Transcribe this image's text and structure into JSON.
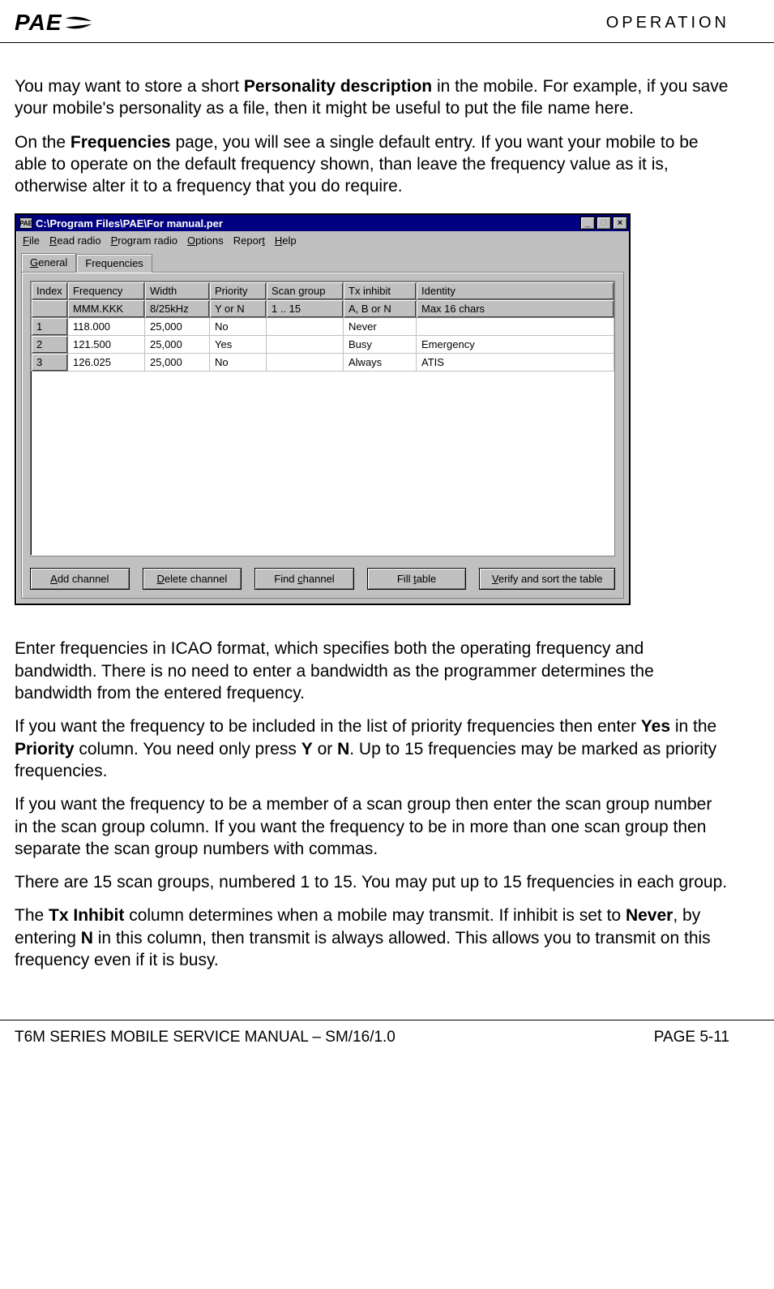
{
  "header": {
    "logo_text": "PAE",
    "section": "OPERATION"
  },
  "para1_a": "You may want to store a short ",
  "para1_b": "Personality description",
  "para1_c": " in the mobile.  For example, if you save your mobile's personality as a file, then it might be useful to put the file name here.",
  "para2_a": "On the ",
  "para2_b": "Frequencies",
  "para2_c": " page, you will see a single default entry.   If you want your mobile to be able to operate on the default frequency shown, than leave the frequency value as it is, otherwise alter it to a frequency that you do require.",
  "window": {
    "title": "C:\\Program Files\\PAE\\For manual.per",
    "icon_text": "PAE",
    "menus": {
      "file": "File",
      "read": "Read radio",
      "program": "Program radio",
      "options": "Options",
      "report": "Report",
      "help": "Help"
    },
    "tabs": {
      "general": "General",
      "frequencies": "Frequencies"
    },
    "columns": {
      "index": "Index",
      "frequency": "Frequency",
      "width": "Width",
      "priority": "Priority",
      "scan": "Scan group",
      "tx": "Tx inhibit",
      "identity": "Identity"
    },
    "hints": {
      "index": "",
      "frequency": "MMM.KKK",
      "width": "8/25kHz",
      "priority": "Y or N",
      "scan": "1 .. 15",
      "tx": "A, B or N",
      "identity": "Max 16 chars"
    },
    "rows": [
      {
        "index": "1",
        "frequency": "118.000",
        "width": "25,000",
        "priority": "No",
        "scan": "",
        "tx": "Never",
        "identity": ""
      },
      {
        "index": "2",
        "frequency": "121.500",
        "width": "25,000",
        "priority": "Yes",
        "scan": "",
        "tx": "Busy",
        "identity": "Emergency"
      },
      {
        "index": "3",
        "frequency": "126.025",
        "width": "25,000",
        "priority": "No",
        "scan": "",
        "tx": "Always",
        "identity": "ATIS"
      }
    ],
    "buttons": {
      "add": "Add channel",
      "delete": "Delete channel",
      "find": "Find channel",
      "fill": "Fill table",
      "verify": "Verify and sort the table"
    }
  },
  "para3": "Enter frequencies in ICAO format, which specifies both the operating frequency and bandwidth.  There is no need to enter a bandwidth as the programmer determines the bandwidth from the entered frequency.",
  "para4_a": "If you want the frequency to be included in the list of priority frequencies then enter ",
  "para4_b": "Yes",
  "para4_c": " in the ",
  "para4_d": "Priority",
  "para4_e": " column.  You need only press ",
  "para4_f": "Y",
  "para4_g": " or ",
  "para4_h": "N",
  "para4_i": ".  Up to 15 frequencies may be marked as priority frequencies.",
  "para5": "If you want the frequency to be a member of a scan group then enter the scan group number in the scan group column.  If you want the frequency to be in more than one scan group then separate the scan group numbers with commas.",
  "para6": "There are 15 scan groups, numbered 1 to 15.  You may put up to 15 frequencies in each group.",
  "para7_a": "The ",
  "para7_b": "Tx Inhibit",
  "para7_c": " column determines when a mobile may transmit.  If inhibit is set to ",
  "para7_d": "Never",
  "para7_e": ", by entering ",
  "para7_f": "N",
  "para7_g": " in this column, then transmit is always allowed.  This allows you to transmit on this frequency even if it is busy.",
  "footer": {
    "left": "T6M SERIES MOBILE SERVICE MANUAL – SM/16/1.0",
    "right": "PAGE 5-11"
  }
}
